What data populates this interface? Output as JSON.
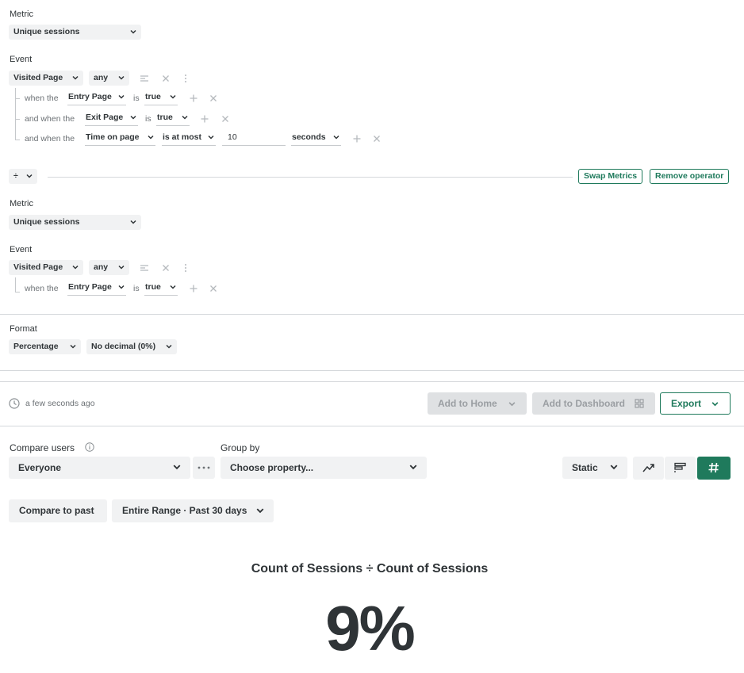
{
  "metric1": {
    "label": "Metric",
    "value": "Unique sessions"
  },
  "event1": {
    "label": "Event",
    "event_name": "Visited Page",
    "qualifier": "any",
    "conditions": [
      {
        "prefix": "when the",
        "property": "Entry Page",
        "op": "is",
        "value": "true"
      },
      {
        "prefix": "and when the",
        "property": "Exit Page",
        "op": "is",
        "value": "true"
      },
      {
        "prefix": "and when the",
        "property": "Time on page",
        "op": "is at most",
        "value": "10",
        "unit": "seconds"
      }
    ]
  },
  "operator": {
    "symbol": "÷",
    "swap_label": "Swap Metrics",
    "remove_label": "Remove operator"
  },
  "metric2": {
    "label": "Metric",
    "value": "Unique sessions"
  },
  "event2": {
    "label": "Event",
    "event_name": "Visited Page",
    "qualifier": "any",
    "conditions": [
      {
        "prefix": "when the",
        "property": "Entry Page",
        "op": "is",
        "value": "true"
      }
    ]
  },
  "format": {
    "label": "Format",
    "type": "Percentage",
    "decimals": "No decimal (0%)"
  },
  "toolbar": {
    "updated": "a few seconds ago",
    "add_home": "Add to Home",
    "add_dashboard": "Add to Dashboard",
    "export": "Export"
  },
  "compare": {
    "label": "Compare users",
    "value": "Everyone",
    "group_label": "Group by",
    "group_placeholder": "Choose property...",
    "mode": "Static",
    "compare_past": "Compare to past",
    "range": "Entire Range · Past 30 days"
  },
  "result": {
    "title": "Count of Sessions ÷ Count of Sessions",
    "value": "9%"
  },
  "colors": {
    "accent": "#1f7a5c",
    "text": "#2f3437",
    "muted": "#9a9ea2"
  }
}
